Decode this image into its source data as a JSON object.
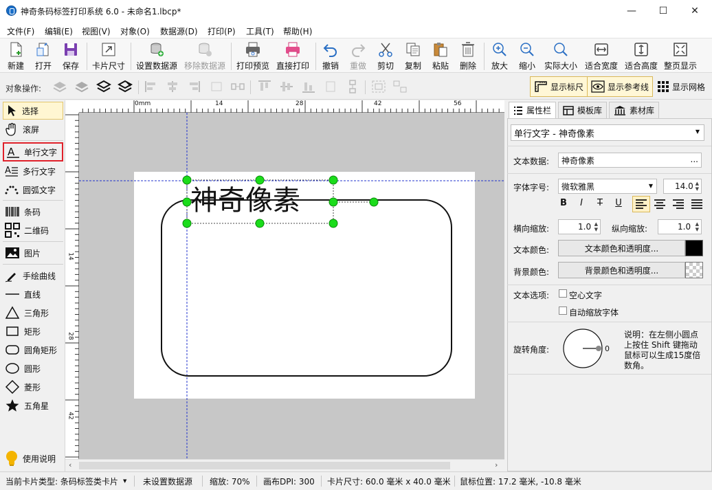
{
  "window": {
    "title": "神奇条码标签打印系统 6.0 - 未命名1.lbcp*",
    "minimize": "—",
    "maximize": "☐",
    "close": "✕"
  },
  "menu": [
    "文件(F)",
    "编辑(E)",
    "视图(V)",
    "对象(O)",
    "数据源(D)",
    "打印(P)",
    "工具(T)",
    "帮助(H)"
  ],
  "toolbar": {
    "new": "新建",
    "open": "打开",
    "save": "保存",
    "card_size": "卡片尺寸",
    "set_datasource": "设置数据源",
    "remove_datasource": "移除数据源",
    "print_preview": "打印预览",
    "direct_print": "直接打印",
    "undo": "撤销",
    "redo": "重做",
    "cut": "剪切",
    "copy": "复制",
    "paste": "粘贴",
    "delete": "删除",
    "zoom_in": "放大",
    "zoom_out": "缩小",
    "actual_size": "实际大小",
    "fit_width": "适合宽度",
    "fit_height": "适合高度",
    "fit_page": "整页显示"
  },
  "ops": {
    "label": "对象操作:",
    "show_ruler": "显示标尺",
    "show_guides": "显示参考线",
    "show_grid": "显示网格"
  },
  "tools": {
    "select": "选择",
    "scroll": "滚屏",
    "single_text": "单行文字",
    "multi_text": "多行文字",
    "arc_text": "圆弧文字",
    "barcode": "条码",
    "qrcode": "二维码",
    "image": "图片",
    "freehand": "手绘曲线",
    "line": "直线",
    "triangle": "三角形",
    "rect": "矩形",
    "round_rect": "圆角矩形",
    "ellipse": "圆形",
    "diamond": "菱形",
    "star": "五角星",
    "help": "使用说明"
  },
  "ruler": {
    "top": [
      "0mm",
      "14",
      "28",
      "42",
      "56"
    ],
    "left": [
      "14",
      "28",
      "42"
    ]
  },
  "label": {
    "text": "神奇像素"
  },
  "panel": {
    "tabs": {
      "props": "属性栏",
      "templates": "模板库",
      "assets": "素材库"
    },
    "object_selector": "单行文字 - 神奇像素",
    "text_data_label": "文本数据:",
    "text_data_value": "神奇像素",
    "ellipsis": "...",
    "font_label": "字体字号:",
    "font_name": "微软雅黑",
    "font_size": "14.0",
    "bold": "B",
    "italic": "I",
    "strike": "T",
    "underline": "U",
    "hscale_label": "横向缩放:",
    "hscale_value": "1.0",
    "vscale_label": "纵向缩放:",
    "vscale_value": "1.0",
    "text_color_label": "文本颜色:",
    "text_color_btn": "文本颜色和透明度...",
    "bg_color_label": "背景颜色:",
    "bg_color_btn": "背景颜色和透明度...",
    "text_options_label": "文本选项:",
    "hollow_text": "空心文字",
    "auto_shrink": "自动缩放字体",
    "rotate_label": "旋转角度:",
    "rotate_value": "0",
    "rotate_hint": "说明：在左侧小圆点上按住 Shift 键拖动鼠标可以生成15度倍数角。",
    "text_color": "#000000"
  },
  "status": {
    "card_type": "当前卡片类型: 条码标签类卡片",
    "datasource": "未设置数据源",
    "zoom": "缩放: 70%",
    "dpi": "画布DPI: 300",
    "card_size": "卡片尺寸: 60.0 毫米 x 40.0 毫米",
    "mouse": "鼠标位置: 17.2 毫米, -10.8 毫米"
  }
}
